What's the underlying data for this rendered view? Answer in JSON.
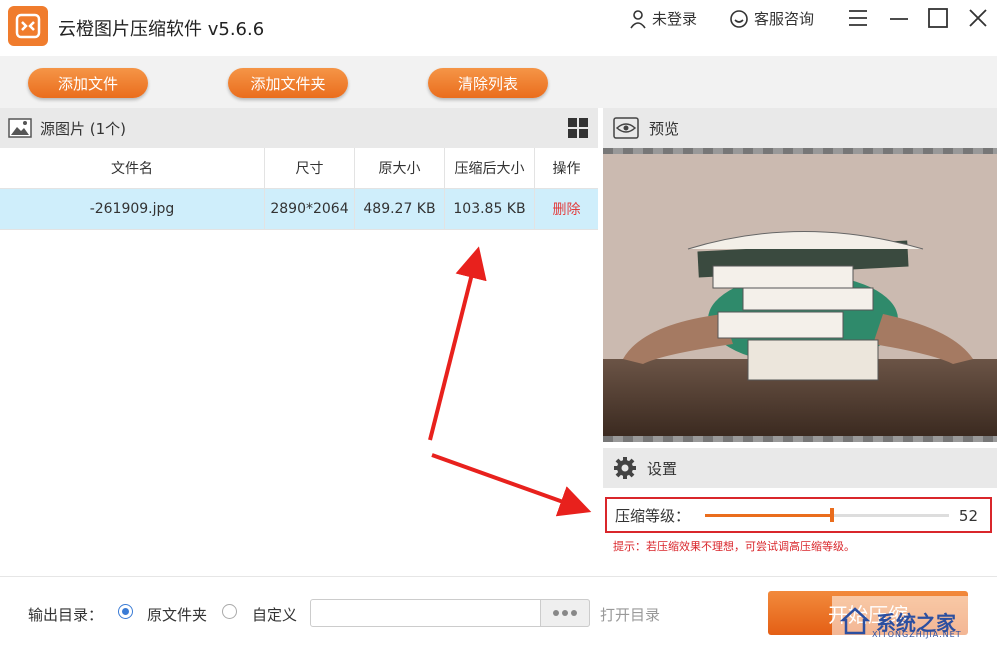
{
  "app": {
    "title": "云橙图片压缩软件 v5.6.6"
  },
  "titlebar": {
    "login": "未登录",
    "service": "客服咨询"
  },
  "toolbar": {
    "add_file": "添加文件",
    "add_folder": "添加文件夹",
    "clear_list": "清除列表"
  },
  "source": {
    "title": "源图片 (1个)"
  },
  "table": {
    "headers": [
      "文件名",
      "尺寸",
      "原大小",
      "压缩后大小",
      "操作"
    ],
    "rows": [
      {
        "name": "-261909.jpg",
        "size": "2890*2064",
        "orig": "489.27 KB",
        "compressed": "103.85 KB",
        "action": "删除"
      }
    ]
  },
  "preview": {
    "title": "预览"
  },
  "settings": {
    "title": "设置",
    "level_label": "压缩等级：",
    "level_value": "52",
    "level_fraction": 0.52,
    "hint": "提示：若压缩效果不理想，可尝试调高压缩等级。"
  },
  "output": {
    "label": "输出目录：",
    "option_original": "原文件夹",
    "option_custom": "自定义",
    "path_value": "",
    "open_dir": "打开目录",
    "start_label": "开始压缩"
  },
  "watermark": {
    "text": "系统之家",
    "sub": "XITONGZHIJIA.NET"
  },
  "colors": {
    "accent": "#ea6d1d",
    "highlight": "#d9262b",
    "row_selected": "#cfeefb"
  }
}
